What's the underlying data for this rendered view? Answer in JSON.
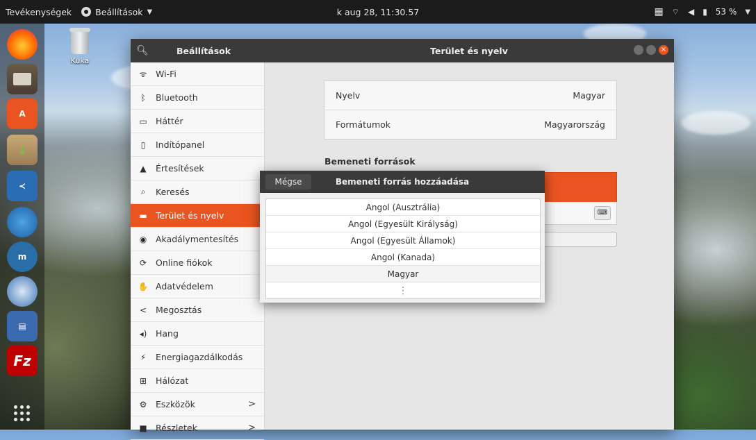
{
  "topbar": {
    "activities": "Tevékenységek",
    "app_menu": "Beállítások",
    "datetime": "k aug 28, 11:30.57",
    "battery": "53 %"
  },
  "desktop": {
    "trash_label": "Kuka"
  },
  "dock": {
    "apps": [
      "firefox-icon",
      "files-icon",
      "software-center-icon",
      "archive-installer-icon",
      "vscode-icon",
      "thunderbird-icon",
      "moodle-icon",
      "thunderbird-alt-icon",
      "remote-desktop-icon",
      "filezilla-icon"
    ]
  },
  "window": {
    "sidebar_title": "Beállítások",
    "title": "Terület és nyelv",
    "sidebar": {
      "items": [
        {
          "label": "Wi-Fi",
          "icon": "wifi-icon"
        },
        {
          "label": "Bluetooth",
          "icon": "bluetooth-icon"
        },
        {
          "label": "Háttér",
          "icon": "background-icon"
        },
        {
          "label": "Indítópanel",
          "icon": "dock-icon"
        },
        {
          "label": "Értesítések",
          "icon": "bell-icon"
        },
        {
          "label": "Keresés",
          "icon": "search-icon"
        },
        {
          "label": "Terület és nyelv",
          "icon": "region-icon",
          "active": true
        },
        {
          "label": "Akadálymentesítés",
          "icon": "accessibility-icon"
        },
        {
          "label": "Online fiókok",
          "icon": "online-accounts-icon"
        },
        {
          "label": "Adatvédelem",
          "icon": "privacy-icon"
        },
        {
          "label": "Megosztás",
          "icon": "share-icon"
        },
        {
          "label": "Hang",
          "icon": "sound-icon"
        },
        {
          "label": "Energiagazdálkodás",
          "icon": "power-icon"
        },
        {
          "label": "Hálózat",
          "icon": "network-icon"
        },
        {
          "label": "Eszközök",
          "icon": "devices-icon",
          "chevron": true
        },
        {
          "label": "Részletek",
          "icon": "details-icon",
          "chevron": true
        }
      ]
    },
    "content": {
      "language_label": "Nyelv",
      "language_value": "Magyar",
      "formats_label": "Formátumok",
      "formats_value": "Magyarország",
      "input_sources_title": "Bemeneti források"
    }
  },
  "dialog": {
    "cancel": "Mégse",
    "title": "Bemeneti forrás hozzáadása",
    "items": [
      "Angol (Ausztrália)",
      "Angol (Egyesült Királyság)",
      "Angol (Egyesült Államok)",
      "Angol (Kanada)",
      "Magyar"
    ],
    "more": "⋮"
  },
  "colors": {
    "accent": "#e95420",
    "headerbar": "#3a3a3a",
    "topbar": "#1b1b1b"
  }
}
